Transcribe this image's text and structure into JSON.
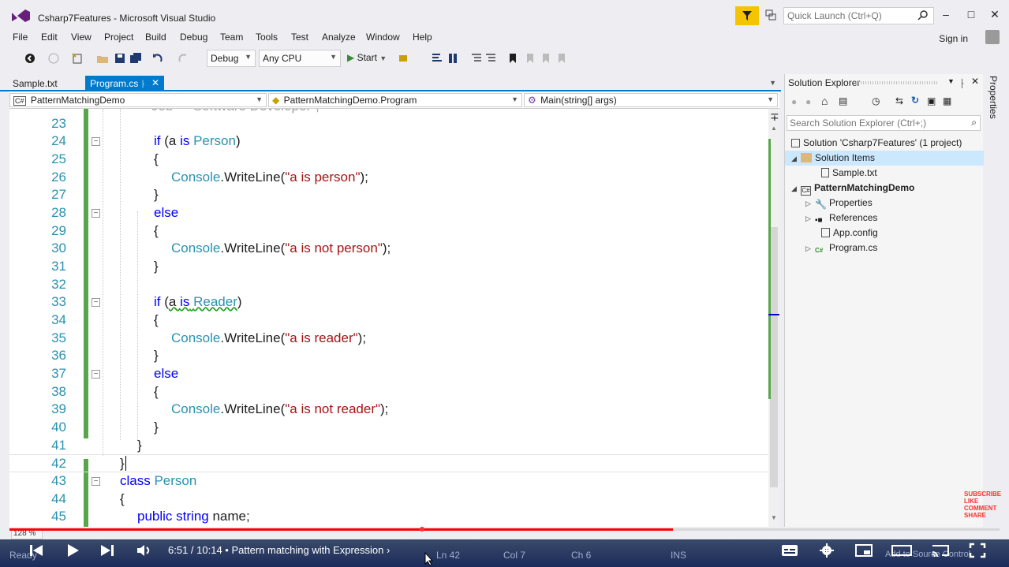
{
  "window": {
    "title": "Csharp7Features - Microsoft Visual Studio",
    "quick_launch_placeholder": "Quick Launch (Ctrl+Q)",
    "sign_in": "Sign in"
  },
  "menu": [
    "File",
    "Edit",
    "View",
    "Project",
    "Build",
    "Debug",
    "Team",
    "Tools",
    "Test",
    "Analyze",
    "Window",
    "Help"
  ],
  "toolbar": {
    "config": "Debug",
    "platform": "Any CPU",
    "start": "Start"
  },
  "tabs": [
    {
      "label": "Sample.txt",
      "active": false
    },
    {
      "label": "Program.cs",
      "active": true
    }
  ],
  "nav": {
    "project": "PatternMatchingDemo",
    "class": "PatternMatchingDemo.Program",
    "member": "Main(string[] args)"
  },
  "code": {
    "lines": [
      {
        "n": "23"
      },
      {
        "n": "24"
      },
      {
        "n": "25"
      },
      {
        "n": "26"
      },
      {
        "n": "27"
      },
      {
        "n": "28"
      },
      {
        "n": "29"
      },
      {
        "n": "30"
      },
      {
        "n": "31"
      },
      {
        "n": "32"
      },
      {
        "n": "33"
      },
      {
        "n": "34"
      },
      {
        "n": "35"
      },
      {
        "n": "36"
      },
      {
        "n": "37"
      },
      {
        "n": "38"
      },
      {
        "n": "39"
      },
      {
        "n": "40"
      },
      {
        "n": "41"
      },
      {
        "n": "42"
      },
      {
        "n": "43"
      },
      {
        "n": "44"
      },
      {
        "n": "45"
      }
    ],
    "strings": {
      "person": "\"a is person\"",
      "not_person": "\"a is not person\"",
      "reader": "\"a is reader\"",
      "not_reader": "\"a is not reader\""
    },
    "keywords": {
      "if": "if",
      "else": "else",
      "class": "class",
      "public": "public",
      "string": "string",
      "is": "is"
    },
    "types": {
      "person": "Person",
      "reader": "Reader",
      "console": "Console"
    },
    "partial_line_22": "Job = \"Software Developer\";"
  },
  "solution_explorer": {
    "title": "Solution Explorer",
    "search_placeholder": "Search Solution Explorer (Ctrl+;)",
    "items": [
      {
        "label": "Solution 'Csharp7Features' (1 project)",
        "icon": "solution-icon"
      },
      {
        "label": "Solution Items",
        "icon": "folder-icon"
      },
      {
        "label": "Sample.txt",
        "icon": "text-file-icon"
      },
      {
        "label": "PatternMatchingDemo",
        "icon": "csharp-project-icon"
      },
      {
        "label": "Properties",
        "icon": "wrench-icon"
      },
      {
        "label": "References",
        "icon": "references-icon"
      },
      {
        "label": "App.config",
        "icon": "config-file-icon"
      },
      {
        "label": "Program.cs",
        "icon": "csharp-file-icon"
      }
    ]
  },
  "properties_tab": "Properties",
  "status": {
    "zoom": "128 %",
    "ready": "Ready",
    "ln": "Ln 42",
    "col": "Col 7",
    "ch": "Ch 6",
    "ins": "INS",
    "add_source": "Add to Source Control"
  },
  "video": {
    "time": "6:51 / 10:14",
    "chapter": "• Pattern matching with Expression",
    "progress": 0.67,
    "badge": [
      "SUBSCRIBE",
      "LIKE",
      "COMMENT",
      "SHARE"
    ]
  },
  "colors": {
    "accent": "#007acc",
    "keyword": "#0000ff",
    "type": "#2b91af",
    "string": "#a31515",
    "change_bar": "#57a64a",
    "notification": "#f5c400"
  }
}
